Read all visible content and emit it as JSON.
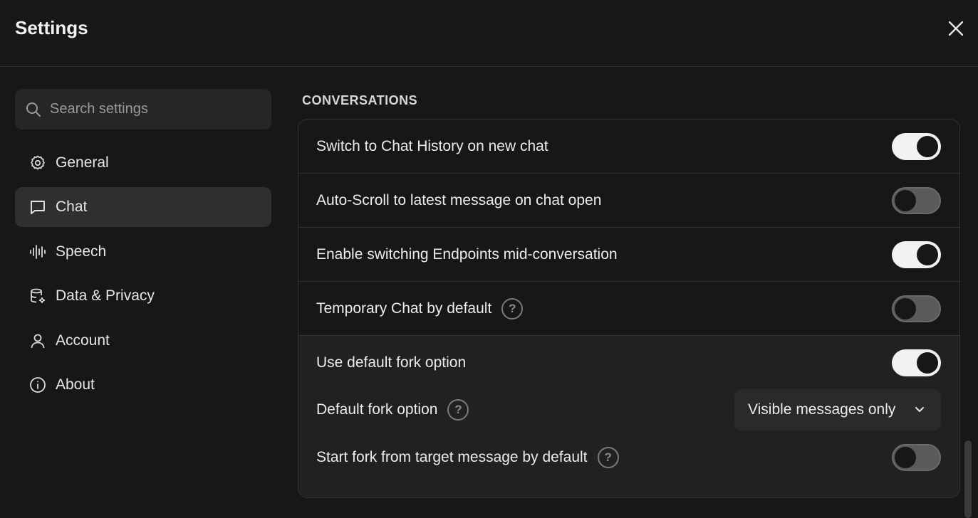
{
  "header": {
    "title": "Settings",
    "close_icon": "close-icon"
  },
  "search": {
    "placeholder": "Search settings",
    "value": ""
  },
  "nav": [
    {
      "label": "General",
      "icon": "gear-icon",
      "active": false
    },
    {
      "label": "Chat",
      "icon": "message-square-icon",
      "active": true
    },
    {
      "label": "Speech",
      "icon": "audio-wave-icon",
      "active": false
    },
    {
      "label": "Data & Privacy",
      "icon": "database-settings-icon",
      "active": false
    },
    {
      "label": "Account",
      "icon": "user-icon",
      "active": false
    },
    {
      "label": "About",
      "icon": "info-icon",
      "active": false
    }
  ],
  "section": {
    "title": "CONVERSATIONS"
  },
  "settings": [
    {
      "label": "Switch to Chat History on new chat",
      "enabled": true
    },
    {
      "label": "Auto-Scroll to latest message on chat open",
      "enabled": false
    },
    {
      "label": "Enable switching Endpoints mid-conversation",
      "enabled": true
    },
    {
      "label": "Temporary Chat by default",
      "enabled": false,
      "help": true
    }
  ],
  "fork": {
    "use_default": {
      "label": "Use default fork option",
      "enabled": true
    },
    "default_option": {
      "label": "Default fork option",
      "value": "Visible messages only",
      "help": true
    },
    "start_from_target": {
      "label": "Start fork from target message by default",
      "enabled": false,
      "help": true
    }
  },
  "colors": {
    "background": "#171717",
    "panel_alt": "#212121",
    "toggle_on": "#f2f2f2",
    "toggle_off": "#5a5a5a"
  }
}
